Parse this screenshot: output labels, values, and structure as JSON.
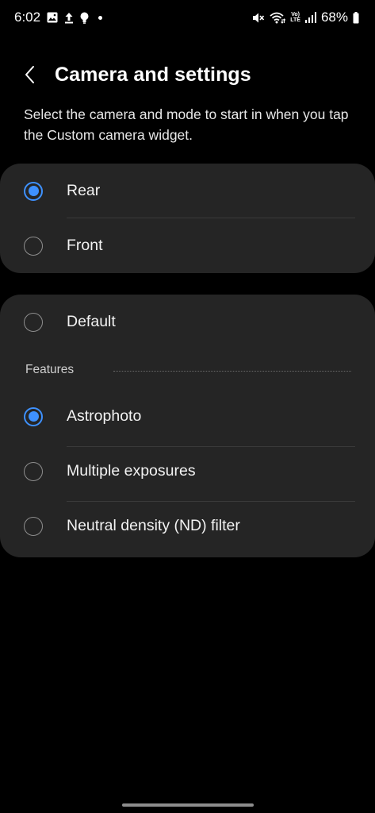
{
  "status_bar": {
    "time": "6:02",
    "battery": "68%",
    "left_icons": [
      "gallery-icon",
      "upload-icon",
      "bulb-icon",
      "dot-icon"
    ],
    "right_icons": [
      "mute-icon",
      "wifi-icon",
      "volte-icon",
      "signal-icon",
      "battery-icon"
    ],
    "volte_top": "Vo)",
    "volte_bottom": "LTE"
  },
  "header": {
    "title": "Camera and settings"
  },
  "description": "Select the camera and mode to start in when you tap the Custom camera widget.",
  "camera_group": {
    "options": [
      {
        "label": "Rear",
        "selected": true
      },
      {
        "label": "Front",
        "selected": false
      }
    ]
  },
  "mode_group": {
    "default_option": {
      "label": "Default",
      "selected": false
    },
    "section_label": "Features",
    "features": [
      {
        "label": "Astrophoto",
        "selected": true
      },
      {
        "label": "Multiple exposures",
        "selected": false
      },
      {
        "label": "Neutral density (ND) filter",
        "selected": false
      }
    ]
  },
  "colors": {
    "accent": "#3e91ff",
    "card_bg": "#252525",
    "background": "#000000"
  }
}
